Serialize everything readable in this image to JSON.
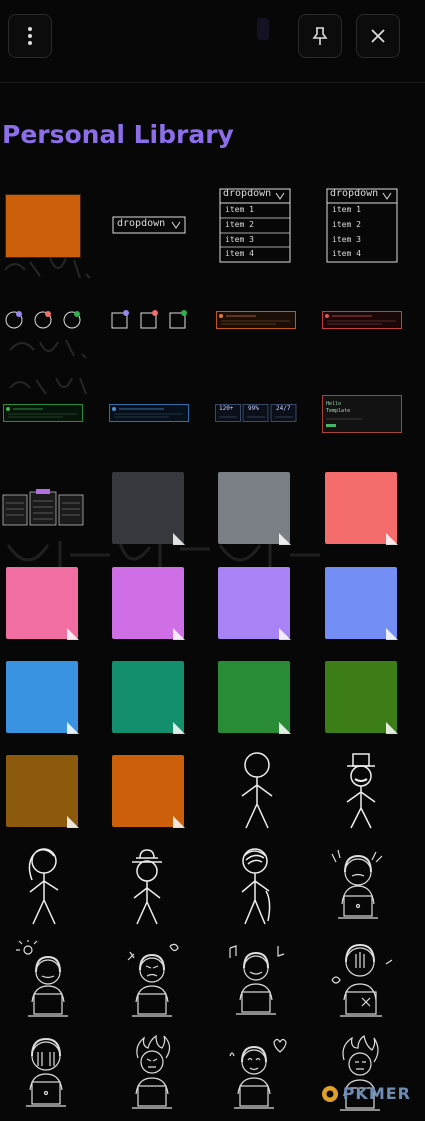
{
  "header": {
    "menu_icon": "more-vertical-icon",
    "pin_icon": "pin-icon",
    "close_icon": "close-icon"
  },
  "library": {
    "title": "Personal Library"
  },
  "dropdowns": {
    "collapsed_label": "dropdown",
    "items": [
      "item 1",
      "item 2",
      "item 3",
      "item 4"
    ]
  },
  "code_block": {
    "lines": [
      "Hello",
      "Template"
    ]
  },
  "stats": [
    "120+",
    "99%",
    "24/7"
  ],
  "colors": {
    "accent": "#8c6fe8",
    "orange": "#cc5f0a",
    "sticky_dark": "#35383d",
    "sticky_gray": "#7a7f85",
    "sticky_red": "#f46c6b",
    "sticky_pink": "#f06ea1",
    "sticky_violet": "#cf6fe6",
    "sticky_lavender": "#a883f5",
    "sticky_blue": "#738ef5",
    "sticky_sky": "#3a93e0",
    "sticky_teal": "#138f6d",
    "sticky_green": "#2a8b36",
    "sticky_olive": "#3d7d17",
    "sticky_brown": "#8c5a0c",
    "sticky_orange": "#cc5f0a"
  },
  "watermark": {
    "text": "PKMER"
  }
}
